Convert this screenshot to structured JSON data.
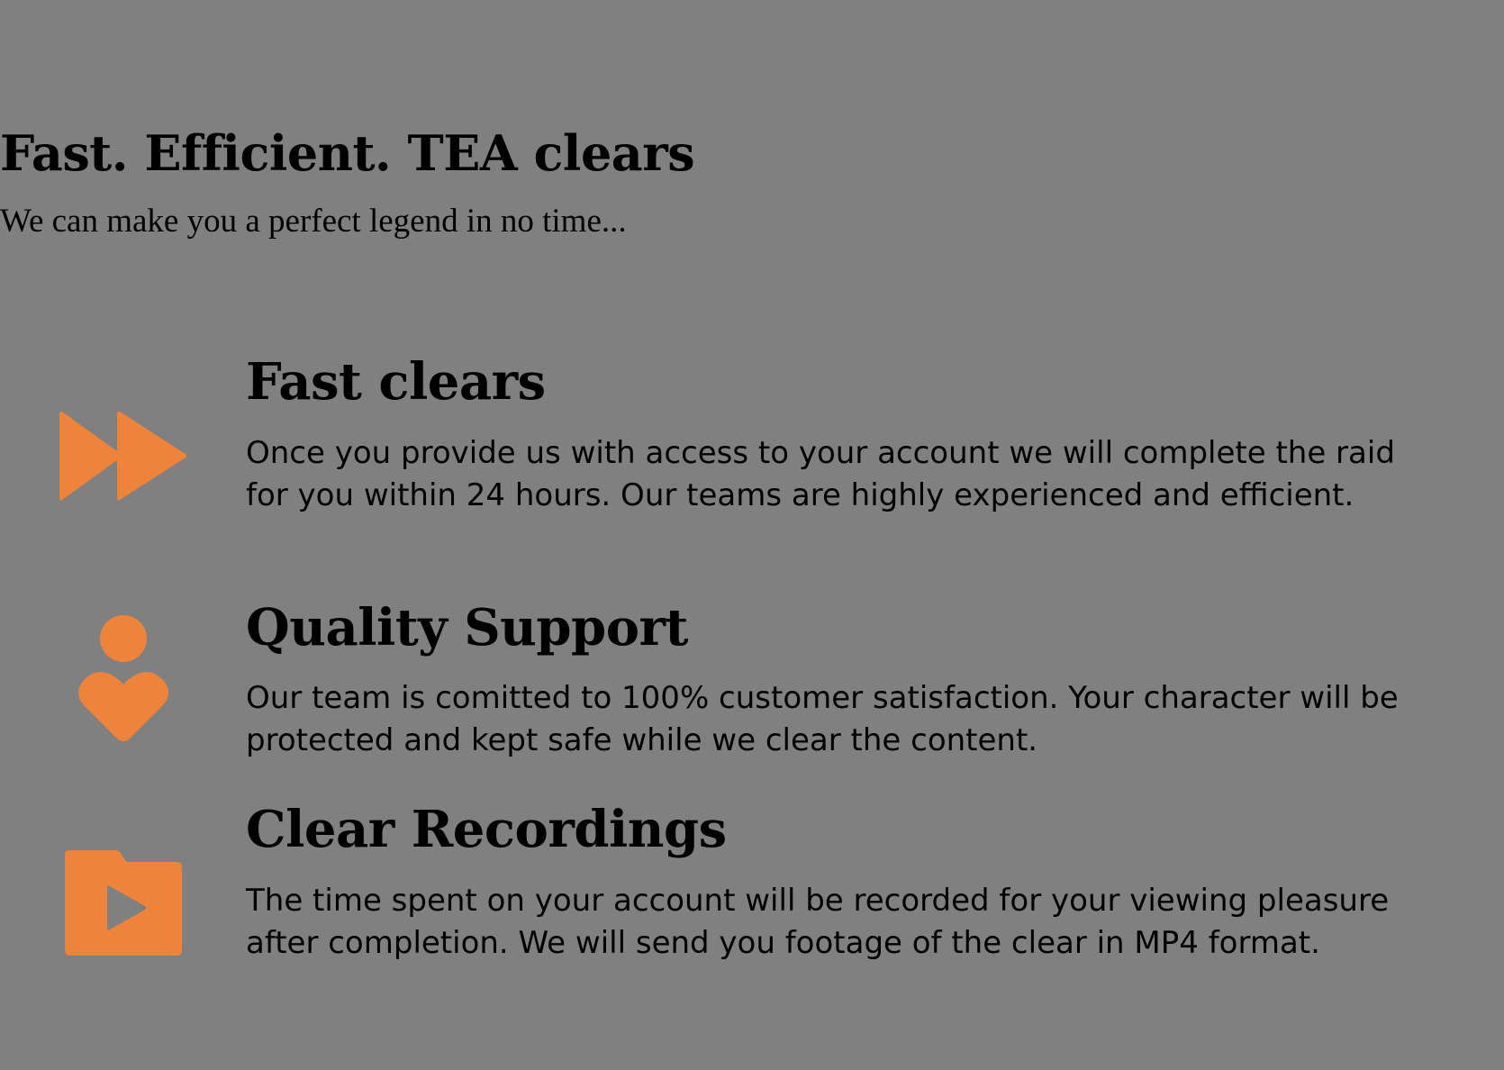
{
  "hero": {
    "title": "Fast. Efficient. TEA clears",
    "subtitle": "We can make you a perfect legend in no time..."
  },
  "features": [
    {
      "icon": "fast-forward-icon",
      "title": "Fast clears",
      "text": "Once you provide us with access to your account we will complete the raid for you within 24 hours. Our teams are highly experienced and efficient."
    },
    {
      "icon": "person-heart-icon",
      "title": "Quality Support",
      "text": "Our team is comitted to 100% customer satisfaction. Your character will be protected and kept safe while we clear the content."
    },
    {
      "icon": "video-folder-icon",
      "title": "Clear Recordings",
      "text": "The time spent on your account will be recorded for your viewing pleasure after completion. We will send you footage of the clear in MP4 format."
    }
  ],
  "colors": {
    "background": "#808080",
    "accent": "#EE833B",
    "text": "#000000"
  }
}
